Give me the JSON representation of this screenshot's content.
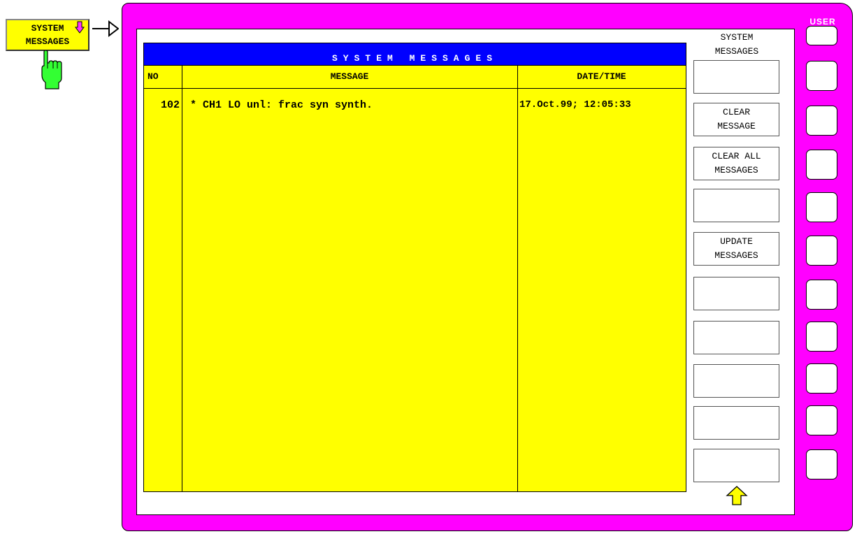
{
  "hardkey": {
    "line1": "SYSTEM",
    "line2": "MESSAGES"
  },
  "frame": {
    "user_label": "USER"
  },
  "table": {
    "title": "SYSTEM MESSAGES",
    "headers": {
      "no": "NO",
      "message": "MESSAGE",
      "datetime": "DATE/TIME"
    },
    "rows": [
      {
        "no": "102",
        "message": "* CH1 LO unl: frac syn synth.",
        "datetime": "17.Oct.99; 12:05:33"
      }
    ]
  },
  "softkeys": {
    "menu_title_1": "SYSTEM",
    "menu_title_2": "MESSAGES",
    "keys": [
      {
        "line1": "",
        "line2": ""
      },
      {
        "line1": "CLEAR",
        "line2": "MESSAGE"
      },
      {
        "line1": "CLEAR ALL",
        "line2": "MESSAGES"
      },
      {
        "line1": "",
        "line2": ""
      },
      {
        "line1": "UPDATE",
        "line2": "MESSAGES"
      },
      {
        "line1": "",
        "line2": ""
      },
      {
        "line1": "",
        "line2": ""
      },
      {
        "line1": "",
        "line2": ""
      },
      {
        "line1": "",
        "line2": ""
      },
      {
        "line1": "",
        "line2": ""
      }
    ]
  },
  "icons": {
    "hand": "pointing-hand-icon",
    "down_arrow": "down-arrow-icon",
    "right_arrow": "right-arrow-icon",
    "up_arrow": "up-arrow-icon"
  },
  "colors": {
    "frame": "#ff00ff",
    "panel": "#ffff00",
    "title_bar": "#0000ff",
    "hand": "#33ff33",
    "down_arrow": "#ff33ff",
    "up_arrow": "#ffff00"
  }
}
